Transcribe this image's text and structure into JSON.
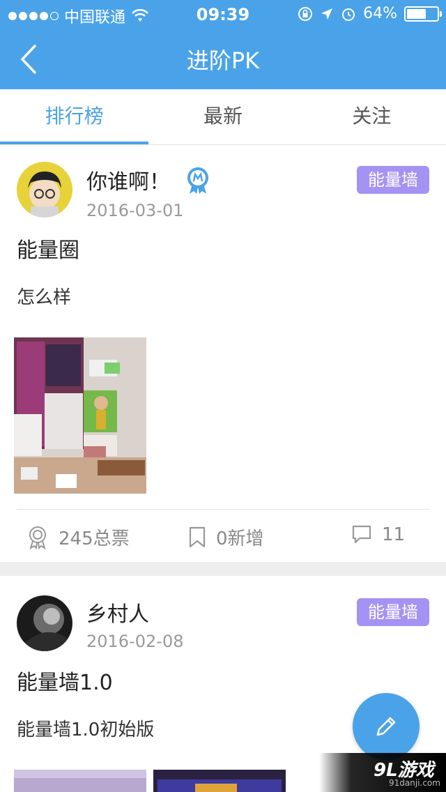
{
  "status_bar": {
    "carrier": "中国联通",
    "time": "09:39",
    "battery": "64%",
    "battery_level": 0.64
  },
  "nav": {
    "title": "进阶PK"
  },
  "tabs": [
    {
      "label": "排行榜",
      "active": true
    },
    {
      "label": "最新",
      "active": false
    },
    {
      "label": "关注",
      "active": false
    }
  ],
  "posts": [
    {
      "username": "你谁啊！",
      "date": "2016-03-01",
      "tag": "能量墙",
      "title": "能量圈",
      "content": "怎么样",
      "votes": "245总票",
      "new_added": "0新增",
      "comments": "11"
    },
    {
      "username": "乡村人",
      "date": "2016-02-08",
      "tag": "能量墙",
      "title": "能量墙1.0",
      "content": "能量墙1.0初始版"
    }
  ],
  "watermark": {
    "main": "9L游戏",
    "sub": "91danji.com"
  },
  "colors": {
    "brand_blue": "#4aa3e8",
    "tag_purple": "#a493f2"
  }
}
